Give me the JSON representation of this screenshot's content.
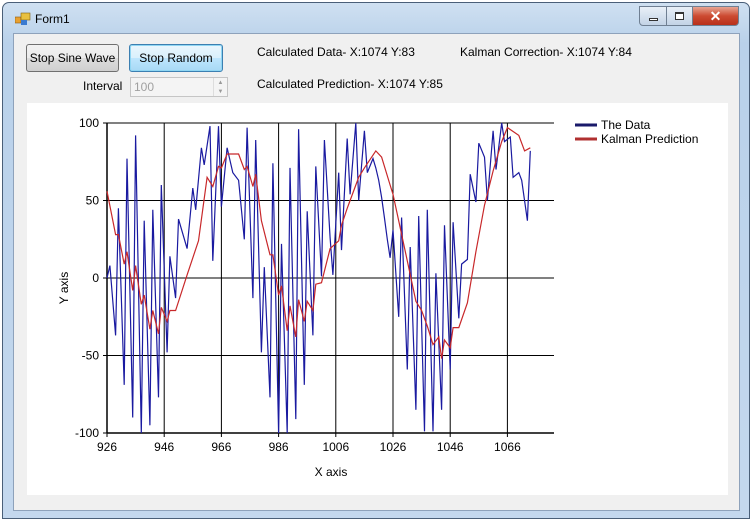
{
  "window": {
    "title": "Form1"
  },
  "controls": {
    "stop_sine_label": "Stop Sine Wave",
    "stop_random_label": "Stop Random",
    "interval_label": "Interval",
    "interval_value": "100"
  },
  "status": {
    "calculated_data": "Calculated Data- X:1074 Y:83",
    "kalman_correction": "Kalman Correction- X:1074 Y:84",
    "calculated_prediction": "Calculated Prediction- X:1074 Y:85"
  },
  "chart_data": {
    "type": "line",
    "xlabel": "X axis",
    "ylabel": "Y axis",
    "xlim": [
      926,
      1075
    ],
    "ylim": [
      -100,
      100
    ],
    "grid": true,
    "legend_position": "top-right",
    "xticks": [
      "926",
      "946",
      "966",
      "986",
      "1006",
      "1026",
      "1046",
      "1066"
    ],
    "yticks": [
      "100",
      "50",
      "0",
      "-50",
      "-100"
    ],
    "series": [
      {
        "name": "The Data",
        "color": "#1a1aa0",
        "x": [
          926,
          927,
          929,
          930,
          932,
          933,
          935,
          936,
          938,
          939,
          941,
          942,
          944,
          945,
          947,
          948,
          950,
          951,
          954,
          956,
          957,
          959,
          960,
          962,
          963,
          965,
          966,
          968,
          970,
          972,
          974,
          975,
          977,
          978,
          980,
          981,
          983,
          984,
          986,
          987,
          989,
          990,
          992,
          993,
          995,
          996,
          998,
          999,
          1001,
          1002,
          1004,
          1005,
          1007,
          1008,
          1010,
          1011,
          1013,
          1014,
          1016,
          1017,
          1019,
          1020,
          1021,
          1022,
          1023,
          1024,
          1025,
          1026,
          1028,
          1029,
          1031,
          1032,
          1034,
          1035,
          1037,
          1038,
          1040,
          1041,
          1043,
          1044,
          1046,
          1047,
          1049,
          1050,
          1052,
          1053,
          1055,
          1056,
          1058,
          1059,
          1061,
          1062,
          1064,
          1065,
          1067,
          1068,
          1070,
          1071,
          1073,
          1074
        ],
        "y": [
          0,
          8,
          -37,
          45,
          -69,
          77,
          -90,
          92,
          -100,
          37,
          -95,
          44,
          -77,
          60,
          -48,
          14,
          -13,
          38,
          19,
          58,
          44,
          84,
          73,
          98,
          11,
          98,
          46,
          84,
          68,
          63,
          25,
          97,
          -13,
          89,
          -48,
          7,
          -77,
          74,
          -100,
          22,
          -100,
          71,
          -91,
          96,
          -69,
          43,
          -37,
          72,
          1,
          89,
          26,
          2,
          68,
          18,
          90,
          54,
          100,
          50,
          95,
          68,
          77,
          71,
          63,
          52,
          39,
          25,
          13,
          31,
          -25,
          39,
          -59,
          20,
          -85,
          40,
          -99,
          44,
          -99,
          3,
          -85,
          34,
          -59,
          36,
          -26,
          9,
          12,
          67,
          49,
          87,
          78,
          50,
          95,
          70,
          100,
          88,
          91,
          65,
          68,
          63,
          37,
          82
        ]
      },
      {
        "name": "Kalman Prediction",
        "color": "#c8282a",
        "x": [
          926,
          929,
          930,
          932,
          933,
          935,
          936,
          938,
          939,
          941,
          942,
          944,
          945,
          947,
          948,
          950,
          954,
          958,
          961,
          963,
          965,
          966,
          968,
          972,
          974,
          975,
          977,
          978,
          980,
          983,
          984,
          986,
          987,
          989,
          990,
          992,
          993,
          995,
          996,
          998,
          999,
          1001,
          1004,
          1007,
          1008,
          1010,
          1011,
          1014,
          1016,
          1020,
          1022,
          1025,
          1026,
          1028,
          1031,
          1034,
          1036,
          1038,
          1040,
          1042,
          1043,
          1044,
          1046,
          1047,
          1049,
          1052,
          1055,
          1058,
          1061,
          1064,
          1066,
          1070,
          1072,
          1074
        ],
        "y": [
          56,
          28,
          28,
          9,
          17,
          -8,
          8,
          -17,
          -11,
          -33,
          -21,
          -36,
          -19,
          -28,
          -21,
          -21,
          2,
          24,
          65,
          59,
          72,
          71,
          80,
          80,
          70,
          72,
          59,
          67,
          37,
          15,
          15,
          -11,
          -5,
          -34,
          -18,
          -38,
          -14,
          -28,
          -15,
          -21,
          -4,
          -3,
          19,
          24,
          34,
          45,
          50,
          65,
          71,
          82,
          78,
          60,
          54,
          37,
          11,
          -15,
          -21,
          -31,
          -43,
          -38,
          -52,
          -40,
          -45,
          -32,
          -32,
          -16,
          17,
          47,
          69,
          88,
          97,
          92,
          82,
          84
        ]
      }
    ]
  }
}
